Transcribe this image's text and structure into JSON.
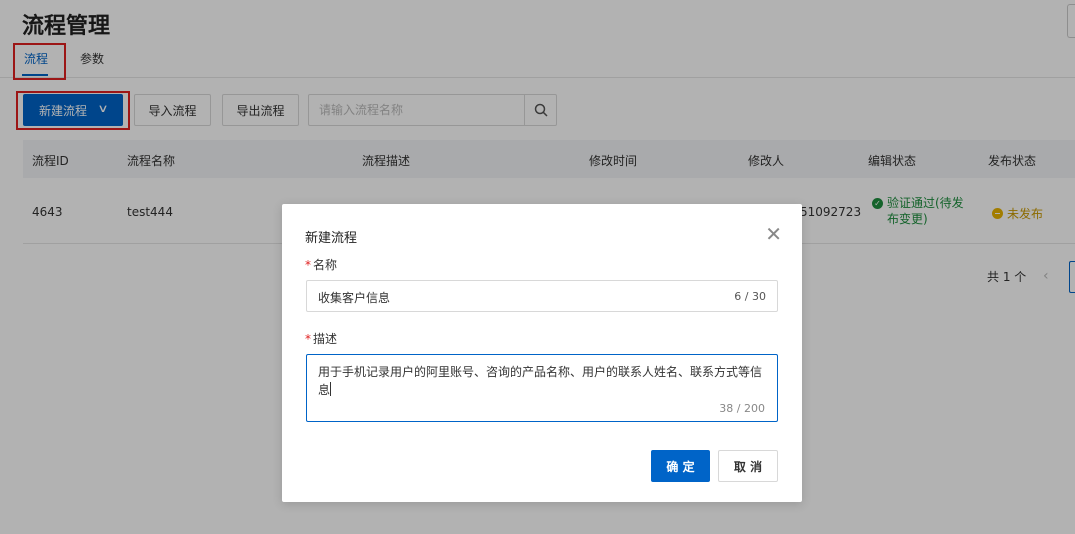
{
  "page": {
    "title": "流程管理"
  },
  "tabs": [
    {
      "label": "流程",
      "active": true
    },
    {
      "label": "参数",
      "active": false
    }
  ],
  "toolbar": {
    "new_label": "新建流程",
    "import_label": "导入流程",
    "export_label": "导出流程",
    "search_placeholder": "请输入流程名称"
  },
  "table": {
    "columns": [
      "流程ID",
      "流程名称",
      "流程描述",
      "修改时间",
      "修改人",
      "编辑状态",
      "发布状态"
    ],
    "rows": [
      {
        "id": "4643",
        "name": "test444",
        "modifier_partial": "51092723",
        "edit_status": "验证通过(待发布变更)",
        "publish_status": "未发布"
      }
    ]
  },
  "pagination": {
    "total_text": "共 1 个"
  },
  "modal": {
    "title": "新建流程",
    "name_label": "名称",
    "name_value": "收集客户信息",
    "name_count": "6 / 30",
    "desc_label": "描述",
    "desc_value": "用于手机记录用户的阿里账号、咨询的产品名称、用户的联系人姓名、联系方式等信息",
    "desc_count": "38 / 200",
    "ok_label": "确 定",
    "cancel_label": "取 消"
  },
  "colors": {
    "primary": "#0064c8",
    "highlight": "#e02020",
    "success": "#1e8e3e",
    "warning": "#c99a00"
  },
  "icons": {
    "search": "search-icon",
    "chevron": "chevron-down-icon",
    "close": "close-icon",
    "success": "check-circle-icon",
    "warning": "minus-circle-icon",
    "prev": "chevron-left-icon"
  }
}
